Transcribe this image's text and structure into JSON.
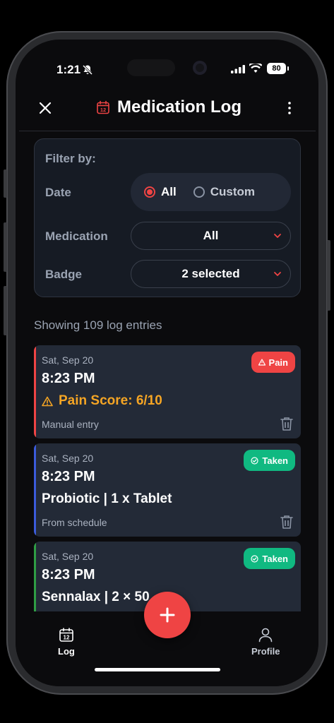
{
  "status_bar": {
    "time": "1:21",
    "battery": "80"
  },
  "header": {
    "title": "Medication Log",
    "calendar_day": "12"
  },
  "filter": {
    "title": "Filter by:",
    "date_label": "Date",
    "date_options": [
      "All",
      "Custom"
    ],
    "date_selected": "All",
    "medication_label": "Medication",
    "medication_value": "All",
    "badge_label": "Badge",
    "badge_value": "2 selected"
  },
  "showing_text": "Showing 109 log entries",
  "entries": [
    {
      "date": "Sat, Sep 20",
      "time": "8:23 PM",
      "main": "Pain Score: 6/10",
      "source": "Manual entry",
      "badge": "Pain",
      "badge_color": "#ef4444",
      "bar_color": "#ef4444",
      "main_color": "#f5a524"
    },
    {
      "date": "Sat, Sep 20",
      "time": "8:23 PM",
      "main": "Probiotic | 1 x Tablet",
      "source": "From schedule",
      "badge": "Taken",
      "badge_color": "#10b981",
      "bar_color": "#3b5bdb"
    },
    {
      "date": "Sat, Sep 20",
      "time": "8:23 PM",
      "main": "Sennalax | 2 × 50",
      "badge": "Taken",
      "badge_color": "#10b981",
      "bar_color": "#2f9e44"
    }
  ],
  "nav": {
    "log_label": "Log",
    "profile_label": "Profile"
  },
  "colors": {
    "accent": "#ef4444",
    "success": "#10b981",
    "warning": "#f5a524"
  }
}
